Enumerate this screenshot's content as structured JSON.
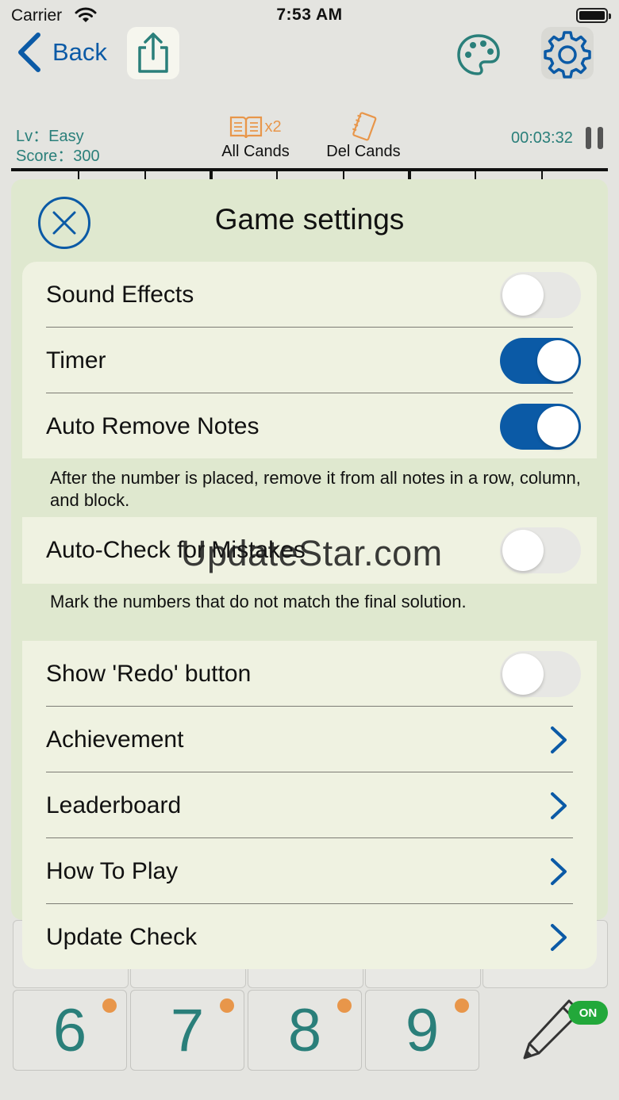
{
  "status_bar": {
    "carrier": "Carrier",
    "time": "7:53 AM"
  },
  "nav": {
    "back_label": "Back"
  },
  "info": {
    "level": "Lv：Easy",
    "score": "Score：300",
    "timer": "00:03:32"
  },
  "tools": {
    "all_cands_multiplier": "x2",
    "all_cands_label": "All Cands",
    "del_cands_label": "Del Cands"
  },
  "settings": {
    "title": "Game settings",
    "sound_effects": {
      "label": "Sound Effects",
      "enabled": false
    },
    "timer": {
      "label": "Timer",
      "enabled": true
    },
    "auto_remove_notes": {
      "label": "Auto Remove Notes",
      "enabled": true,
      "note": "After the number is placed, remove it from all notes in a row, column, and block."
    },
    "auto_check": {
      "label": "Auto-Check for Mistakes",
      "enabled": false,
      "note": "Mark the numbers that do not match the final solution."
    },
    "show_redo": {
      "label": "Show 'Redo' button",
      "enabled": false
    },
    "achievement": {
      "label": "Achievement"
    },
    "leaderboard": {
      "label": "Leaderboard"
    },
    "how_to_play": {
      "label": "How To Play"
    },
    "update_check": {
      "label": "Update Check"
    }
  },
  "number_pad": {
    "keys": [
      "6",
      "7",
      "8",
      "9"
    ],
    "pencil_badge": "ON"
  },
  "watermark": "UpdateStar.com",
  "colors": {
    "accent": "#0b5aa6",
    "teal": "#2a7f7a",
    "orange": "#e8964a",
    "modal_bg": "#dfe8cf",
    "group_bg": "#eff2e1",
    "badge_green": "#22a83a"
  }
}
